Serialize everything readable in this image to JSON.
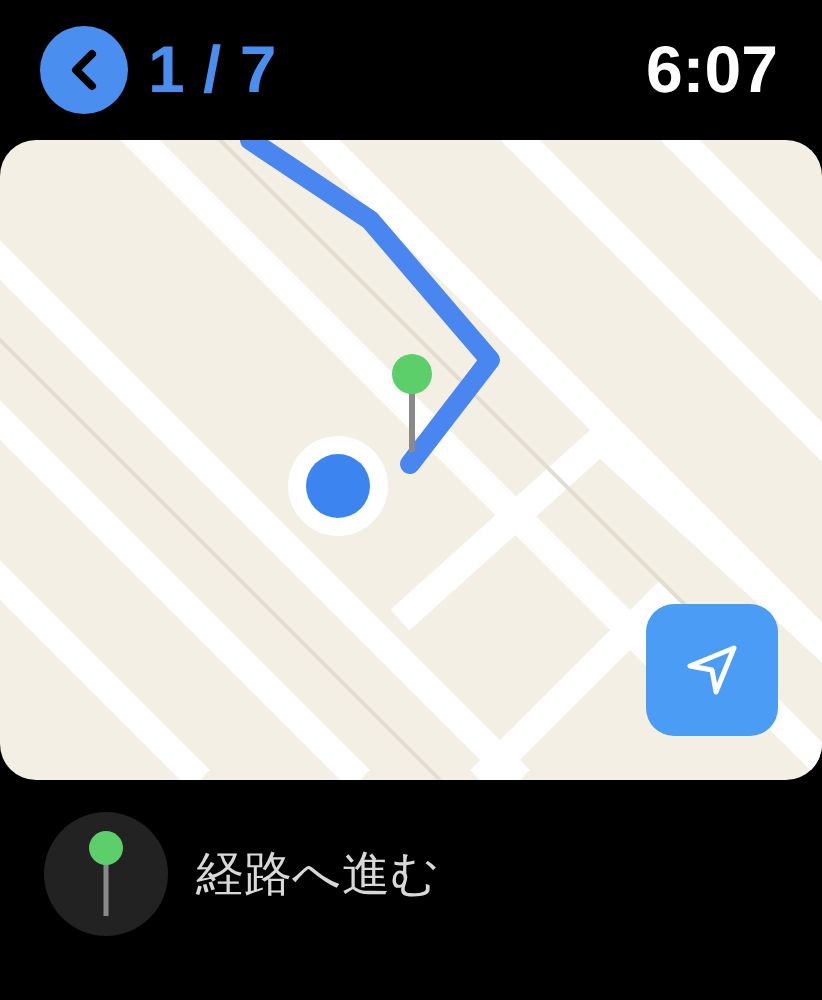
{
  "header": {
    "page": "1 / 7",
    "time": "6:07"
  },
  "action": {
    "label": "経路へ進む"
  }
}
